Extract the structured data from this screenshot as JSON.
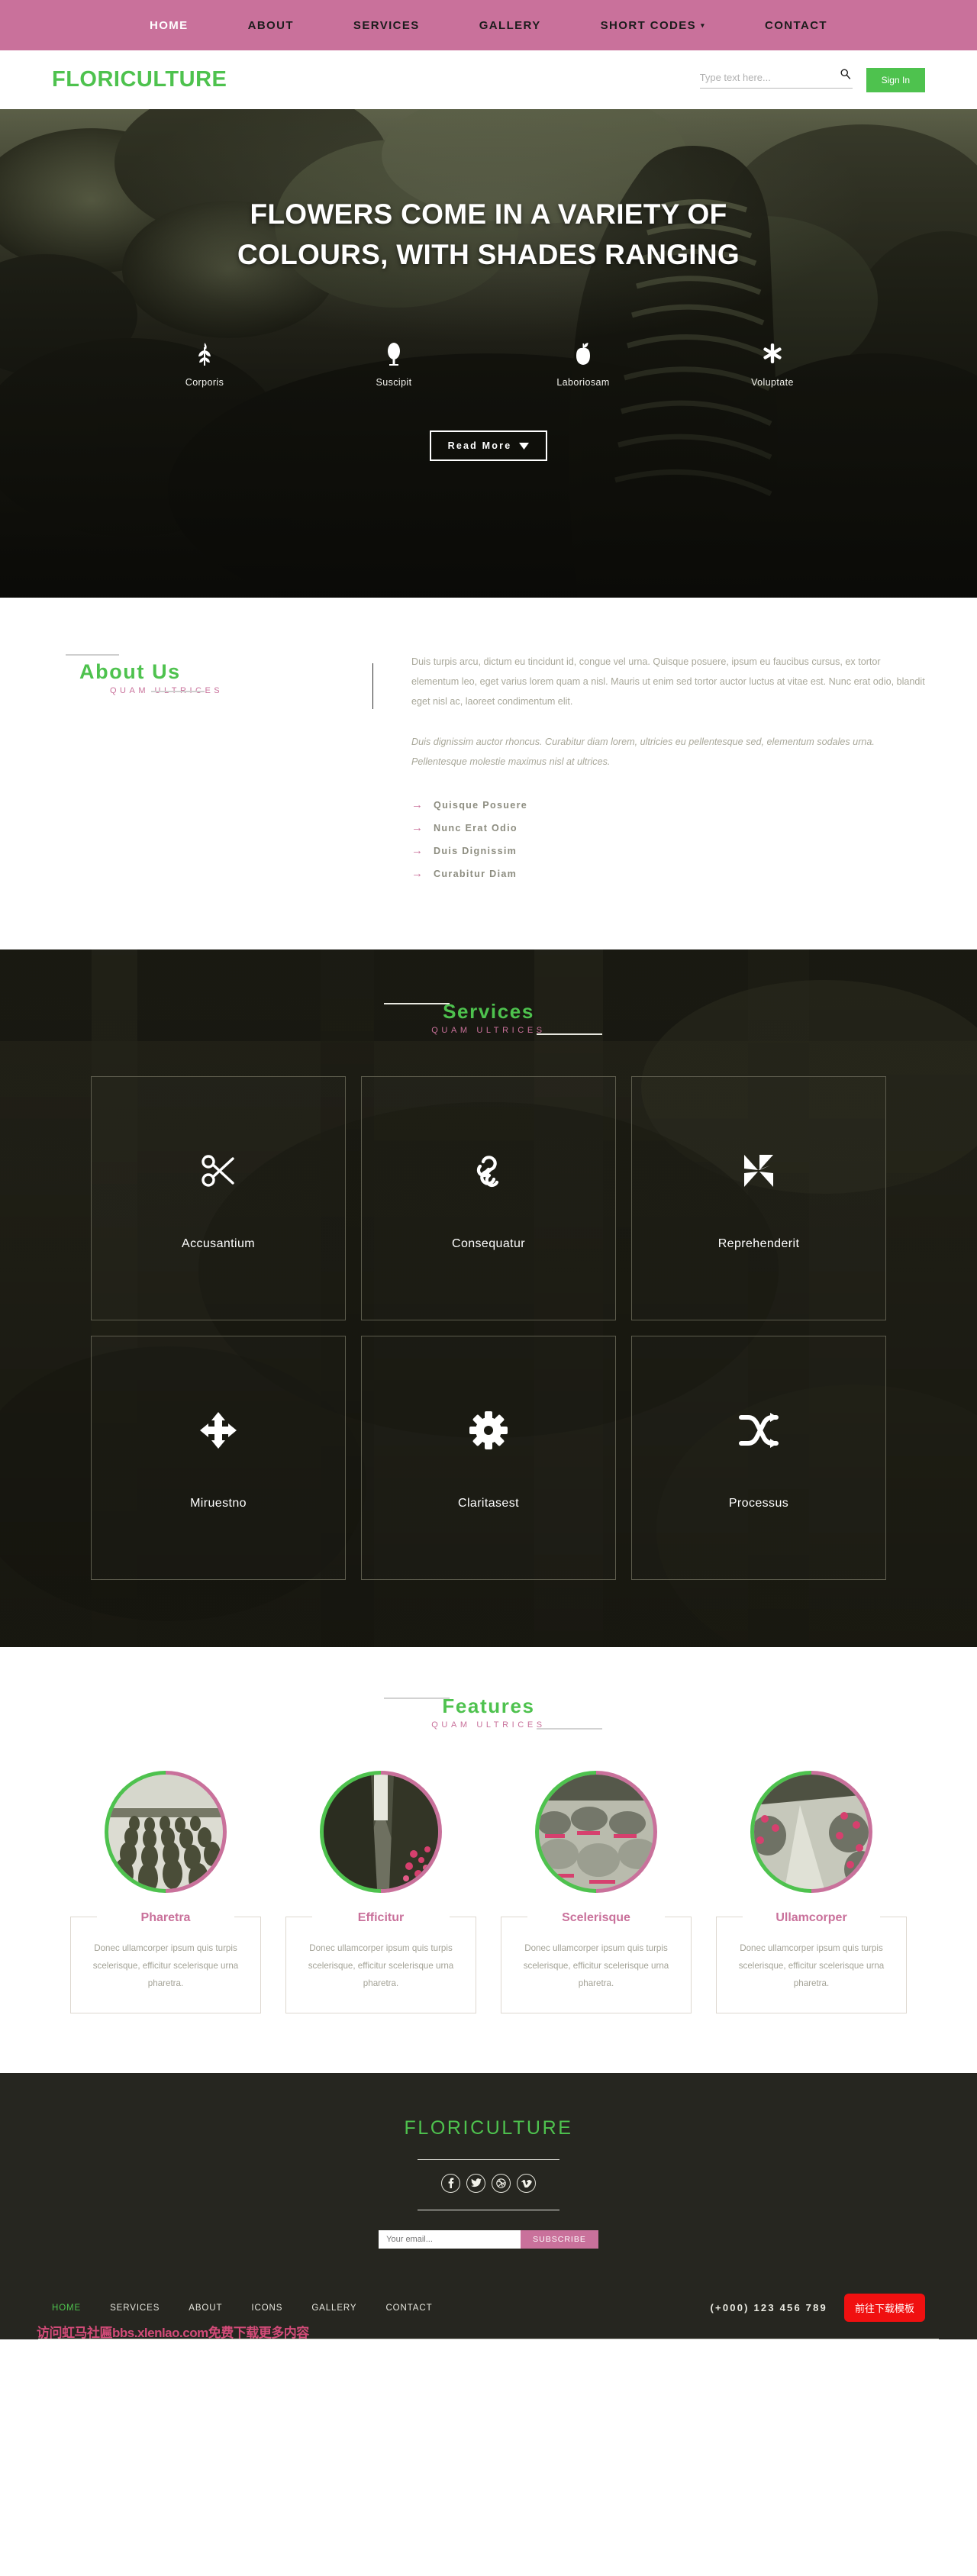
{
  "topnav": {
    "items": [
      {
        "label": "HOME",
        "active": true,
        "caret": false
      },
      {
        "label": "ABOUT",
        "active": false,
        "caret": false
      },
      {
        "label": "SERVICES",
        "active": false,
        "caret": false
      },
      {
        "label": "GALLERY",
        "active": false,
        "caret": false
      },
      {
        "label": "SHORT CODES",
        "active": false,
        "caret": true
      },
      {
        "label": "CONTACT",
        "active": false,
        "caret": false
      }
    ],
    "caret_glyph": "▾",
    "bg_color": "#c9719b"
  },
  "brandbar": {
    "logo": "FLORICULTURE",
    "logo_color": "#4ec24e",
    "search_placeholder": "Type text here...",
    "search_value": "",
    "search_icon": "search-icon",
    "signin_label": "Sign In",
    "signin_color": "#4ec24e"
  },
  "hero": {
    "title": "FLOWERS COME IN A VARIETY OF COLOURS, WITH SHADES RANGING",
    "icons": [
      {
        "label": "Corporis",
        "icon": "wheat-sprout-icon"
      },
      {
        "label": "Suscipit",
        "icon": "tree-icon"
      },
      {
        "label": "Laboriosam",
        "icon": "apple-icon"
      },
      {
        "label": "Voluptate",
        "icon": "flower-asterisk-icon"
      }
    ],
    "cta_label": "Read More",
    "cta_icon": "chevron-down-icon"
  },
  "about": {
    "title": "About Us",
    "subtitle": "QUAM ULTRICES",
    "paragraph1": "Duis turpis arcu, dictum eu tincidunt id, congue vel urna. Quisque posuere, ipsum eu faucibus cursus, ex tortor elementum leo, eget varius lorem quam a nisl. Mauris ut enim sed tortor auctor luctus at vitae est. Nunc erat odio, blandit eget nisl ac, laoreet condimentum elit.",
    "paragraph2": "Duis dignissim auctor rhoncus. Curabitur diam lorem, ultricies eu pellentesque sed, elementum sodales urna. Pellentesque molestie maximus nisl at ultrices.",
    "arrow_glyph": "→",
    "list": [
      "Quisque Posuere",
      "Nunc Erat Odio",
      "Duis Dignissim",
      "Curabitur Diam"
    ]
  },
  "services": {
    "title": "Services",
    "subtitle": "QUAM ULTRICES",
    "cards": [
      {
        "label": "Accusantium",
        "icon": "scissors-icon"
      },
      {
        "label": "Consequatur",
        "icon": "chain-link-icon"
      },
      {
        "label": "Reprehenderit",
        "icon": "pinwheel-icon"
      },
      {
        "label": "Miruestno",
        "icon": "arrows-move-icon"
      },
      {
        "label": "Claritasest",
        "icon": "gear-icon"
      },
      {
        "label": "Processus",
        "icon": "shuffle-icon"
      }
    ]
  },
  "features": {
    "title": "Features",
    "subtitle": "QUAM ULTRICES",
    "ring_left_color": "#4ec24e",
    "ring_right_color": "#c9719b",
    "cards": [
      {
        "title": "Pharetra",
        "text": "Donec ullamcorper ipsum quis turpis scelerisque, efficitur scelerisque urna pharetra.",
        "image": "nursery-rows-photo"
      },
      {
        "title": "Efficitur",
        "text": "Donec ullamcorper ipsum quis turpis scelerisque, efficitur scelerisque urna pharetra.",
        "image": "greenhouse-path-photo"
      },
      {
        "title": "Scelerisque",
        "text": "Donec ullamcorper ipsum quis turpis scelerisque, efficitur scelerisque urna pharetra.",
        "image": "flower-beds-photo"
      },
      {
        "title": "Ullamcorper",
        "text": "Donec ullamcorper ipsum quis turpis scelerisque, efficitur scelerisque urna pharetra.",
        "image": "greenhouse-blooms-photo"
      }
    ]
  },
  "footer": {
    "logo": "FLORICULTURE",
    "socials": [
      {
        "name": "facebook-icon",
        "glyph": "f"
      },
      {
        "name": "twitter-icon",
        "glyph": "🐦"
      },
      {
        "name": "dribbble-icon",
        "glyph": "◎"
      },
      {
        "name": "vimeo-icon",
        "glyph": "v"
      }
    ],
    "email_placeholder": "Your email...",
    "email_value": "",
    "subscribe_label": "SUBSCRIBE",
    "nav": [
      {
        "label": "HOME",
        "active": true
      },
      {
        "label": "SERVICES",
        "active": false
      },
      {
        "label": "ABOUT",
        "active": false
      },
      {
        "label": "ICONS",
        "active": false
      },
      {
        "label": "GALLERY",
        "active": false
      },
      {
        "label": "CONTACT",
        "active": false
      }
    ],
    "phone": "(+000) 123 456 789",
    "download_label": "前往下载模板",
    "download_color": "#f01010",
    "watermark": "访问虹马社匾bbs.xlenlao.com免费下载更多内容"
  }
}
